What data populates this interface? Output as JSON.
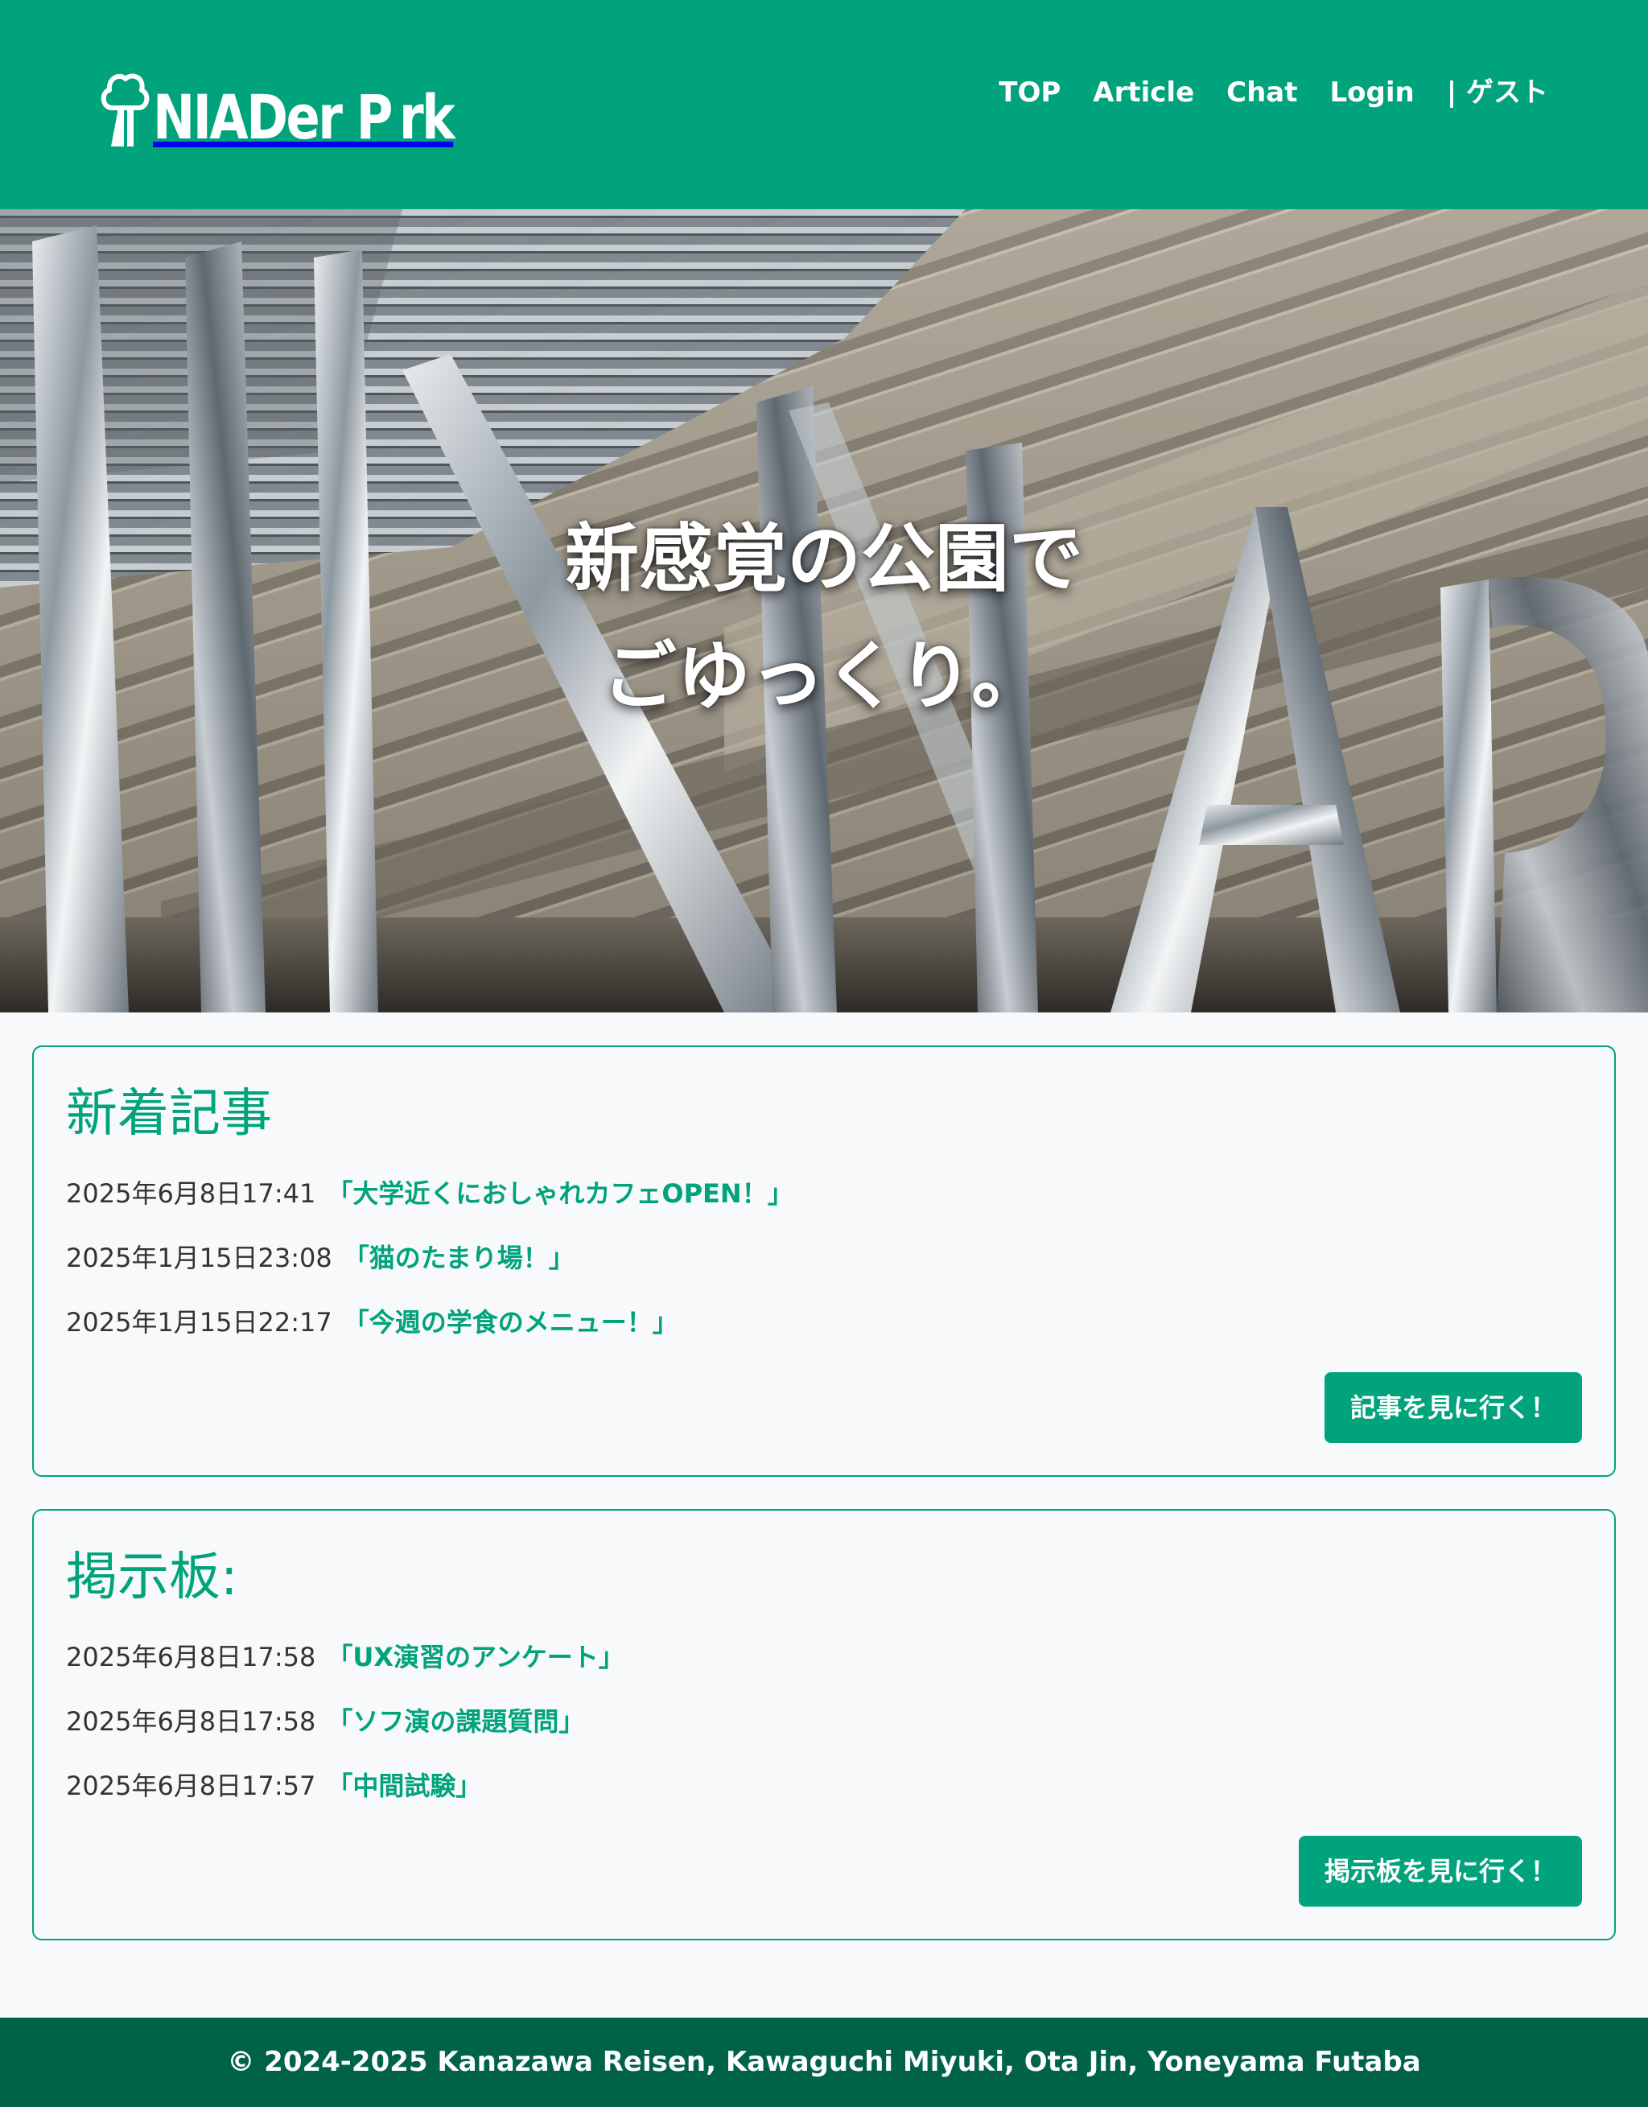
{
  "header": {
    "logo_text": "NIADer P rk",
    "nav": [
      {
        "label": "TOP"
      },
      {
        "label": "Article"
      },
      {
        "label": "Chat"
      },
      {
        "label": "Login"
      }
    ],
    "user_label": "| ゲスト"
  },
  "hero": {
    "line1": "新感覚の公園で",
    "line2": "ごゆっくり。"
  },
  "articles": {
    "title": "新着記事",
    "items": [
      {
        "date": "2025年6月8日17:41",
        "title": "「大学近くにおしゃれカフェOPEN！」"
      },
      {
        "date": "2025年1月15日23:08",
        "title": "「猫のたまり場！」"
      },
      {
        "date": "2025年1月15日22:17",
        "title": "「今週の学食のメニュー！」"
      }
    ],
    "button_label": "記事を見に行く！"
  },
  "board": {
    "title": "掲示板:",
    "items": [
      {
        "date": "2025年6月8日17:58",
        "title": "「UX演習のアンケート」"
      },
      {
        "date": "2025年6月8日17:58",
        "title": "「ソフ演の課題質問」"
      },
      {
        "date": "2025年6月8日17:57",
        "title": "「中間試験」"
      }
    ],
    "button_label": "掲示板を見に行く！"
  },
  "footer": {
    "copyright": "© 2024-2025 Kanazawa Reisen, Kawaguchi Miyuki, Ota Jin, Yoneyama Futaba"
  },
  "colors": {
    "brand": "#00a37c",
    "footer": "#006246",
    "background": "#f8f9fa"
  }
}
